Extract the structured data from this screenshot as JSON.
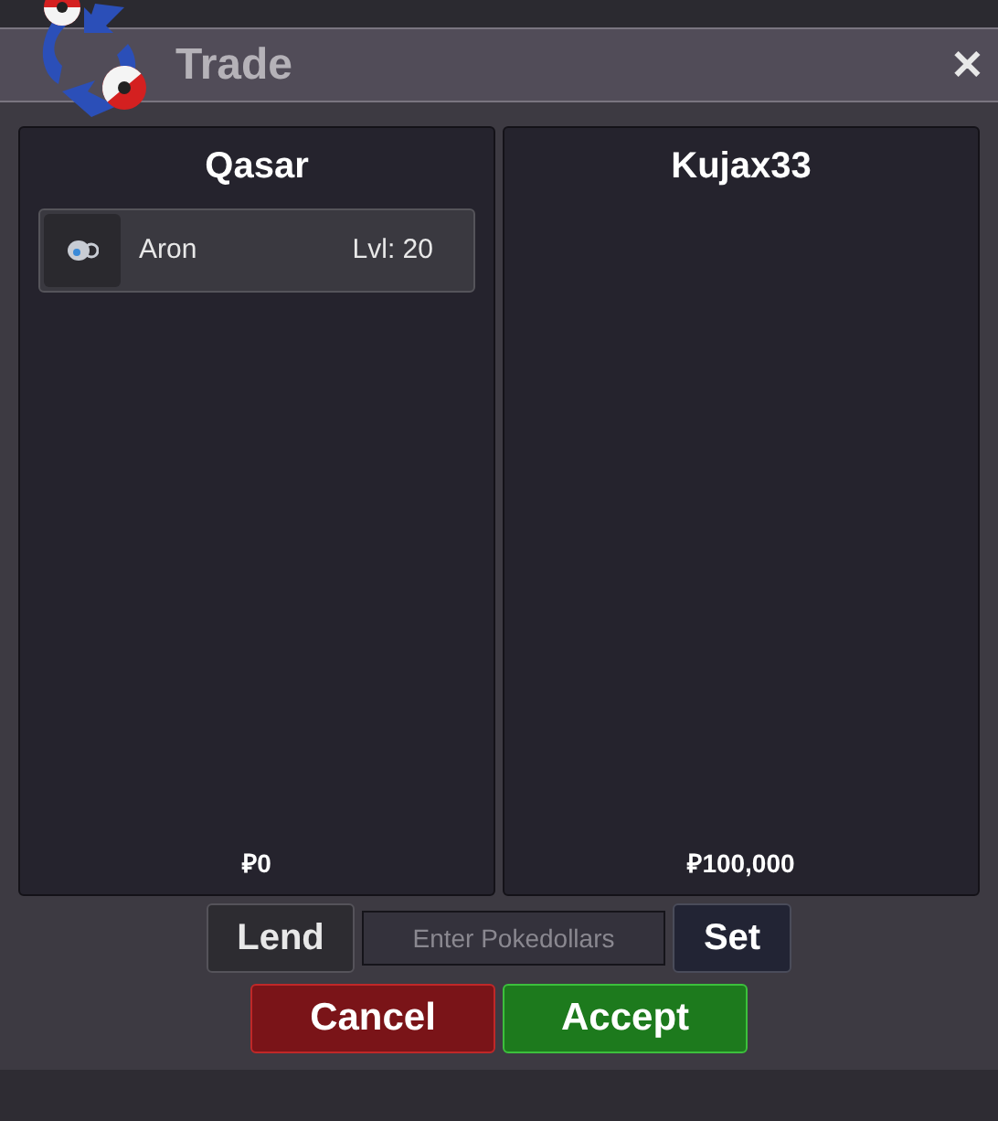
{
  "window": {
    "title": "Trade",
    "close": "✕"
  },
  "panels": [
    {
      "name": "Qasar",
      "items": [
        {
          "name": "Aron",
          "level": "Lvl: 20"
        }
      ],
      "money": "₽0"
    },
    {
      "name": "Kujax33",
      "money": "₽100,000"
    }
  ],
  "controls": {
    "lend": "Lend",
    "placeholder": "Enter Pokedollars",
    "set": "Set"
  },
  "buttons": [
    {
      "label": "Cancel",
      "kind": "cancel"
    },
    {
      "label": "Accept",
      "kind": "accept"
    }
  ]
}
